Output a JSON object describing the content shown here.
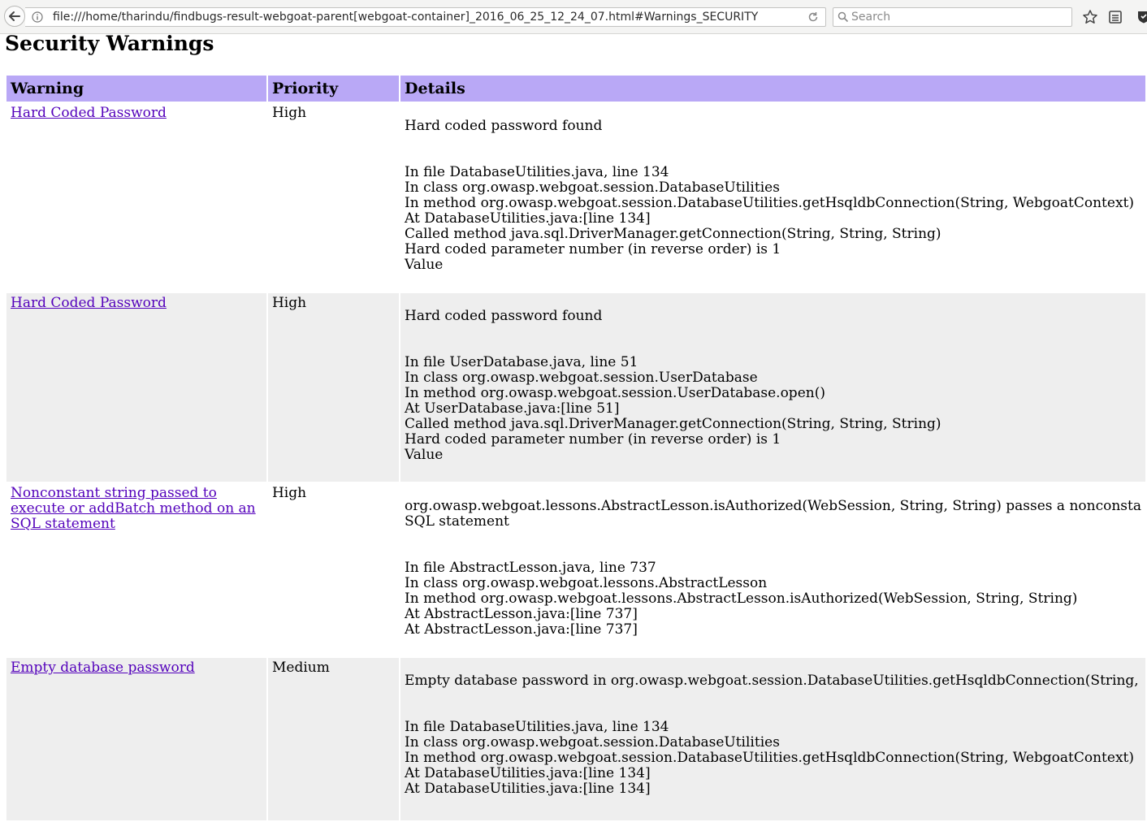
{
  "browser": {
    "url": "file:///home/tharindu/findbugs-result-webgoat-parent[webgoat-container]_2016_06_25_12_24_07.html#Warnings_SECURITY",
    "search_placeholder": "Search",
    "icons": [
      "back-arrow-icon",
      "info-icon",
      "reload-icon",
      "search-icon",
      "star-icon",
      "reading-list-icon",
      "shield-icon"
    ]
  },
  "page": {
    "title": "Security Warnings"
  },
  "table": {
    "headers": [
      "Warning",
      "Priority",
      "Details"
    ],
    "rows": [
      {
        "warning": "Hard Coded Password",
        "priority": "High",
        "summary": "Hard coded password found",
        "lines": [
          "In file DatabaseUtilities.java, line 134",
          "In class org.owasp.webgoat.session.DatabaseUtilities",
          "In method org.owasp.webgoat.session.DatabaseUtilities.getHsqldbConnection(String, WebgoatContext)",
          "At DatabaseUtilities.java:[line 134]",
          "Called method java.sql.DriverManager.getConnection(String, String, String)",
          "Hard coded parameter number (in reverse order) is 1",
          "Value"
        ]
      },
      {
        "warning": "Hard Coded Password",
        "priority": "High",
        "summary": "Hard coded password found",
        "lines": [
          "In file UserDatabase.java, line 51",
          "In class org.owasp.webgoat.session.UserDatabase",
          "In method org.owasp.webgoat.session.UserDatabase.open()",
          "At UserDatabase.java:[line 51]",
          "Called method java.sql.DriverManager.getConnection(String, String, String)",
          "Hard coded parameter number (in reverse order) is 1",
          "Value"
        ]
      },
      {
        "warning": "Nonconstant string passed to execute or addBatch method on an SQL statement",
        "priority": "High",
        "summary": "org.owasp.webgoat.lessons.AbstractLesson.isAuthorized(WebSession, String, String) passes a nonconsta",
        "summary2": "SQL statement",
        "lines": [
          "In file AbstractLesson.java, line 737",
          "In class org.owasp.webgoat.lessons.AbstractLesson",
          "In method org.owasp.webgoat.lessons.AbstractLesson.isAuthorized(WebSession, String, String)",
          "At AbstractLesson.java:[line 737]",
          "At AbstractLesson.java:[line 737]"
        ]
      },
      {
        "warning": "Empty database password",
        "priority": "Medium",
        "summary": "Empty database password in org.owasp.webgoat.session.DatabaseUtilities.getHsqldbConnection(String,",
        "lines": [
          "In file DatabaseUtilities.java, line 134",
          "In class org.owasp.webgoat.session.DatabaseUtilities",
          "In method org.owasp.webgoat.session.DatabaseUtilities.getHsqldbConnection(String, WebgoatContext)",
          "At DatabaseUtilities.java:[line 134]",
          "At DatabaseUtilities.java:[line 134]"
        ]
      }
    ]
  }
}
